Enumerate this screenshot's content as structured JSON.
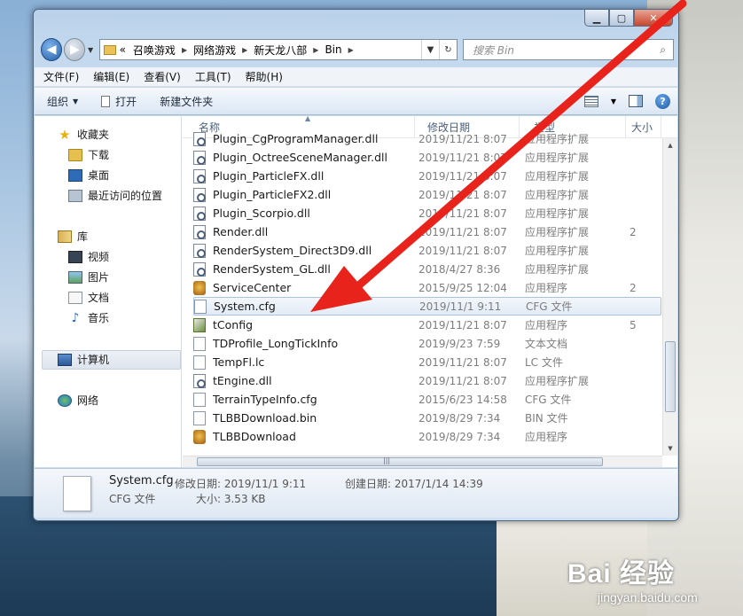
{
  "window": {
    "caption": {
      "minimize": "▁",
      "maximize": "▢",
      "close": "✕"
    },
    "address": {
      "crumbs": [
        "召唤游戏",
        "网络游戏",
        "新天龙八部",
        "Bin"
      ],
      "prefix": "«",
      "refresh_icon": "↻"
    },
    "search_placeholder": "搜索 Bin",
    "menu": [
      "文件(F)",
      "编辑(E)",
      "查看(V)",
      "工具(T)",
      "帮助(H)"
    ],
    "toolbar": {
      "organize": "组织",
      "open": "打开",
      "new_folder": "新建文件夹",
      "help": "?"
    },
    "nav": {
      "favorites": "收藏夹",
      "downloads": "下载",
      "desktop": "桌面",
      "recent": "最近访问的位置",
      "libraries": "库",
      "videos": "视频",
      "pictures": "图片",
      "documents": "文档",
      "music": "音乐",
      "computer": "计算机",
      "network": "网络"
    },
    "columns": {
      "name": "名称",
      "date": "修改日期",
      "type": "类型",
      "size": "大小"
    },
    "files": [
      {
        "name": "Plugin_CgProgramManager.dll",
        "date": "2019/11/21 8:07",
        "type": "应用程序扩展",
        "size": "",
        "icon": "dll"
      },
      {
        "name": "Plugin_OctreeSceneManager.dll",
        "date": "2019/11/21 8:07",
        "type": "应用程序扩展",
        "size": "",
        "icon": "dll"
      },
      {
        "name": "Plugin_ParticleFX.dll",
        "date": "2019/11/21 8:07",
        "type": "应用程序扩展",
        "size": "",
        "icon": "dll"
      },
      {
        "name": "Plugin_ParticleFX2.dll",
        "date": "2019/11/21 8:07",
        "type": "应用程序扩展",
        "size": "",
        "icon": "dll"
      },
      {
        "name": "Plugin_Scorpio.dll",
        "date": "2019/11/21 8:07",
        "type": "应用程序扩展",
        "size": "",
        "icon": "dll"
      },
      {
        "name": "Render.dll",
        "date": "2019/11/21 8:07",
        "type": "应用程序扩展",
        "size": "2",
        "icon": "dll"
      },
      {
        "name": "RenderSystem_Direct3D9.dll",
        "date": "2019/11/21 8:07",
        "type": "应用程序扩展",
        "size": "",
        "icon": "dll"
      },
      {
        "name": "RenderSystem_GL.dll",
        "date": "2018/4/27 8:36",
        "type": "应用程序扩展",
        "size": "",
        "icon": "dll"
      },
      {
        "name": "ServiceCenter",
        "date": "2015/9/25 12:04",
        "type": "应用程序",
        "size": "2",
        "icon": "app"
      },
      {
        "name": "System.cfg",
        "date": "2019/11/1 9:11",
        "type": "CFG 文件",
        "size": "",
        "icon": "doc"
      },
      {
        "name": "tConfig",
        "date": "2019/11/21 8:07",
        "type": "应用程序",
        "size": "5",
        "icon": "tconf"
      },
      {
        "name": "TDProfile_LongTickInfo",
        "date": "2019/9/23 7:59",
        "type": "文本文档",
        "size": "",
        "icon": "doc"
      },
      {
        "name": "TempFl.lc",
        "date": "2019/11/21 8:07",
        "type": "LC 文件",
        "size": "",
        "icon": "doc"
      },
      {
        "name": "tEngine.dll",
        "date": "2019/11/21 8:07",
        "type": "应用程序扩展",
        "size": "",
        "icon": "dll"
      },
      {
        "name": "TerrainTypeInfo.cfg",
        "date": "2015/6/23 14:58",
        "type": "CFG 文件",
        "size": "",
        "icon": "doc"
      },
      {
        "name": "TLBBDownload.bin",
        "date": "2019/8/29 7:34",
        "type": "BIN 文件",
        "size": "",
        "icon": "doc"
      },
      {
        "name": "TLBBDownload",
        "date": "2019/8/29 7:34",
        "type": "应用程序",
        "size": "",
        "icon": "app"
      }
    ],
    "selected_file": "System.cfg",
    "details": {
      "name": "System.cfg",
      "type": "CFG 文件",
      "modified": "修改日期: 2019/11/1 9:11",
      "size": "大小: 3.53 KB",
      "created": "创建日期: 2017/1/14 14:39"
    }
  },
  "watermark": {
    "logo": "Bai 经验",
    "url": "jingyan.baidu.com"
  },
  "colors": {
    "arrow": "#e8231c",
    "selection": "#e2ebf6",
    "titlebar": "#c4d9ee"
  }
}
